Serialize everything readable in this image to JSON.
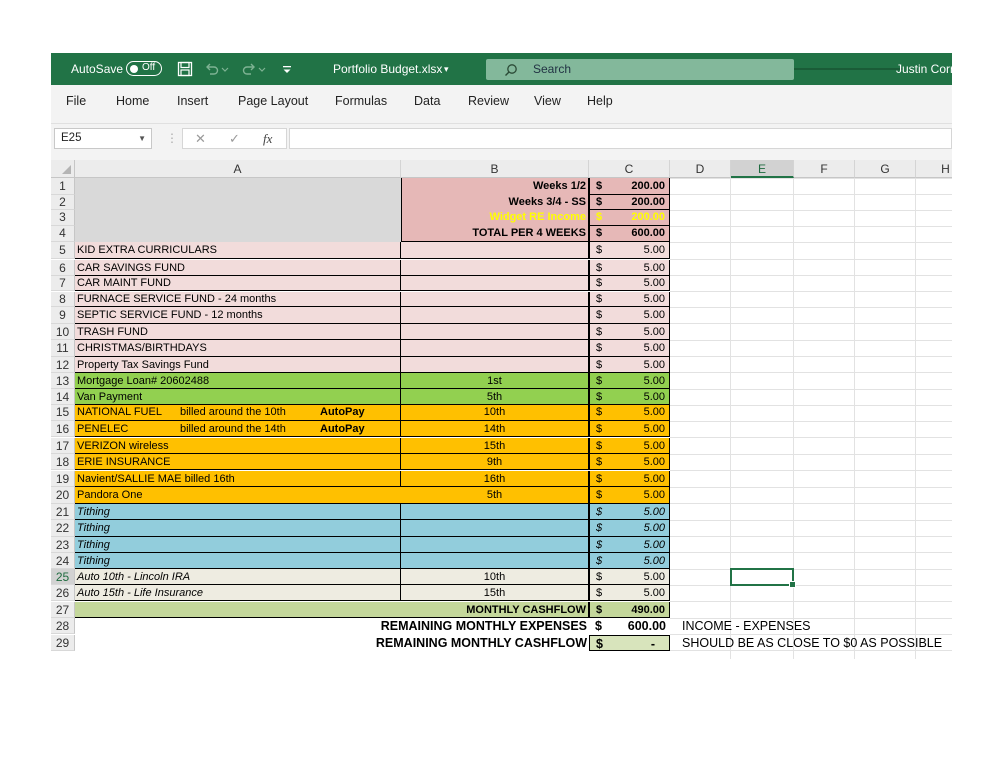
{
  "titlebar": {
    "autosave_label": "AutoSave",
    "autosave_state": "Off",
    "file_name": "Portfolio Budget.xlsx",
    "search_placeholder": "Search",
    "user_name": "Justin Corri"
  },
  "menu": [
    "File",
    "Home",
    "Insert",
    "Page Layout",
    "Formulas",
    "Data",
    "Review",
    "View",
    "Help"
  ],
  "formula_bar": {
    "name_box": "E25",
    "cancel_symbol": "✕",
    "enter_symbol": "✓",
    "fx_symbol": "fx",
    "formula_value": ""
  },
  "columns": [
    "A",
    "B",
    "C",
    "D",
    "E",
    "F",
    "G",
    "H"
  ],
  "selected_cell": "E25",
  "colors": {
    "title_green": "#217346",
    "pink_header": "#e6b8b7",
    "pink_fill": "#f2dcdb",
    "grey_fill": "#d9d9d9",
    "green_fill": "#92d050",
    "orange_fill": "#ffc000",
    "blue_fill": "#92cddc",
    "cream_fill": "#eeece1",
    "olive_fill": "#c4d79b",
    "light_green_fill": "#d8e4bc",
    "yellow_text": "#ffff00"
  },
  "rows": [
    {
      "num": "1",
      "a": "",
      "b": "Weeks 1/2",
      "c_sym": "$",
      "c_val": "200.00"
    },
    {
      "num": "2",
      "a": "",
      "b": "Weeks 3/4 - SS",
      "c_sym": "$",
      "c_val": "200.00"
    },
    {
      "num": "3",
      "a": "",
      "b": "Widget RE Income",
      "c_sym": "$",
      "c_val": "200.00"
    },
    {
      "num": "4",
      "a": "",
      "b": "TOTAL PER 4 WEEKS",
      "c_sym": "$",
      "c_val": "600.00"
    },
    {
      "num": "5",
      "a": "KID EXTRA CURRICULARS",
      "b": "",
      "c_sym": "$",
      "c_val": "5.00"
    },
    {
      "num": "6",
      "a": "CAR SAVINGS FUND",
      "b": "",
      "c_sym": "$",
      "c_val": "5.00"
    },
    {
      "num": "7",
      "a": "CAR MAINT FUND",
      "b": "",
      "c_sym": "$",
      "c_val": "5.00"
    },
    {
      "num": "8",
      "a": "FURNACE SERVICE FUND - 24 months",
      "b": "",
      "c_sym": "$",
      "c_val": "5.00"
    },
    {
      "num": "9",
      "a": "SEPTIC SERVICE FUND - 12 months",
      "b": "",
      "c_sym": "$",
      "c_val": "5.00"
    },
    {
      "num": "10",
      "a": "TRASH FUND",
      "b": "",
      "c_sym": "$",
      "c_val": "5.00"
    },
    {
      "num": "11",
      "a": "CHRISTMAS/BIRTHDAYS",
      "b": "",
      "c_sym": "$",
      "c_val": "5.00"
    },
    {
      "num": "12",
      "a": "Property Tax Savings Fund",
      "b": "",
      "c_sym": "$",
      "c_val": "5.00"
    },
    {
      "num": "13",
      "a": "Mortgage   Loan# 20602488",
      "b": "1st",
      "c_sym": "$",
      "c_val": "5.00"
    },
    {
      "num": "14",
      "a": "Van Payment",
      "b": "5th",
      "c_sym": "$",
      "c_val": "5.00"
    },
    {
      "num": "15",
      "a": "NATIONAL FUEL",
      "a_note": "billed around the 10th",
      "a_tag": "AutoPay",
      "b": "10th",
      "c_sym": "$",
      "c_val": "5.00"
    },
    {
      "num": "16",
      "a": "PENELEC",
      "a_note": "billed around the 14th",
      "a_tag": "AutoPay",
      "b": "14th",
      "c_sym": "$",
      "c_val": "5.00"
    },
    {
      "num": "17",
      "a": "VERIZON wireless",
      "b": "15th",
      "c_sym": "$",
      "c_val": "5.00"
    },
    {
      "num": "18",
      "a": "ERIE INSURANCE",
      "b": "9th",
      "c_sym": "$",
      "c_val": "5.00"
    },
    {
      "num": "19",
      "a": "Navient/SALLIE MAE  billed 16th",
      "b": "16th",
      "c_sym": "$",
      "c_val": "5.00"
    },
    {
      "num": "20",
      "a": "Pandora One",
      "b": "5th",
      "c_sym": "$",
      "c_val": "5.00"
    },
    {
      "num": "21",
      "a": "Tithing",
      "b": "",
      "c_sym": "$",
      "c_val": "5.00"
    },
    {
      "num": "22",
      "a": "Tithing",
      "b": "",
      "c_sym": "$",
      "c_val": "5.00"
    },
    {
      "num": "23",
      "a": "Tithing",
      "b": "",
      "c_sym": "$",
      "c_val": "5.00"
    },
    {
      "num": "24",
      "a": "Tithing",
      "b": "",
      "c_sym": "$",
      "c_val": "5.00"
    },
    {
      "num": "25",
      "a": "Auto 10th  - Lincoln IRA",
      "b": "10th",
      "c_sym": "$",
      "c_val": "5.00"
    },
    {
      "num": "26",
      "a": "Auto 15th - Life Insurance",
      "b": "15th",
      "c_sym": "$",
      "c_val": "5.00"
    },
    {
      "num": "27",
      "a": "",
      "b": "MONTHLY CASHFLOW",
      "c_sym": "$",
      "c_val": "490.00"
    },
    {
      "num": "28",
      "a": "",
      "b": "REMAINING MONTHLY EXPENSES",
      "c_sym": "$",
      "c_val": "600.00",
      "d": "INCOME - EXPENSES"
    },
    {
      "num": "29",
      "a": "",
      "b": "REMAINING MONTHLY CASHFLOW",
      "c_sym": "$",
      "c_val": "-",
      "d": "SHOULD BE AS CLOSE TO $0 AS POSSIBLE"
    }
  ]
}
